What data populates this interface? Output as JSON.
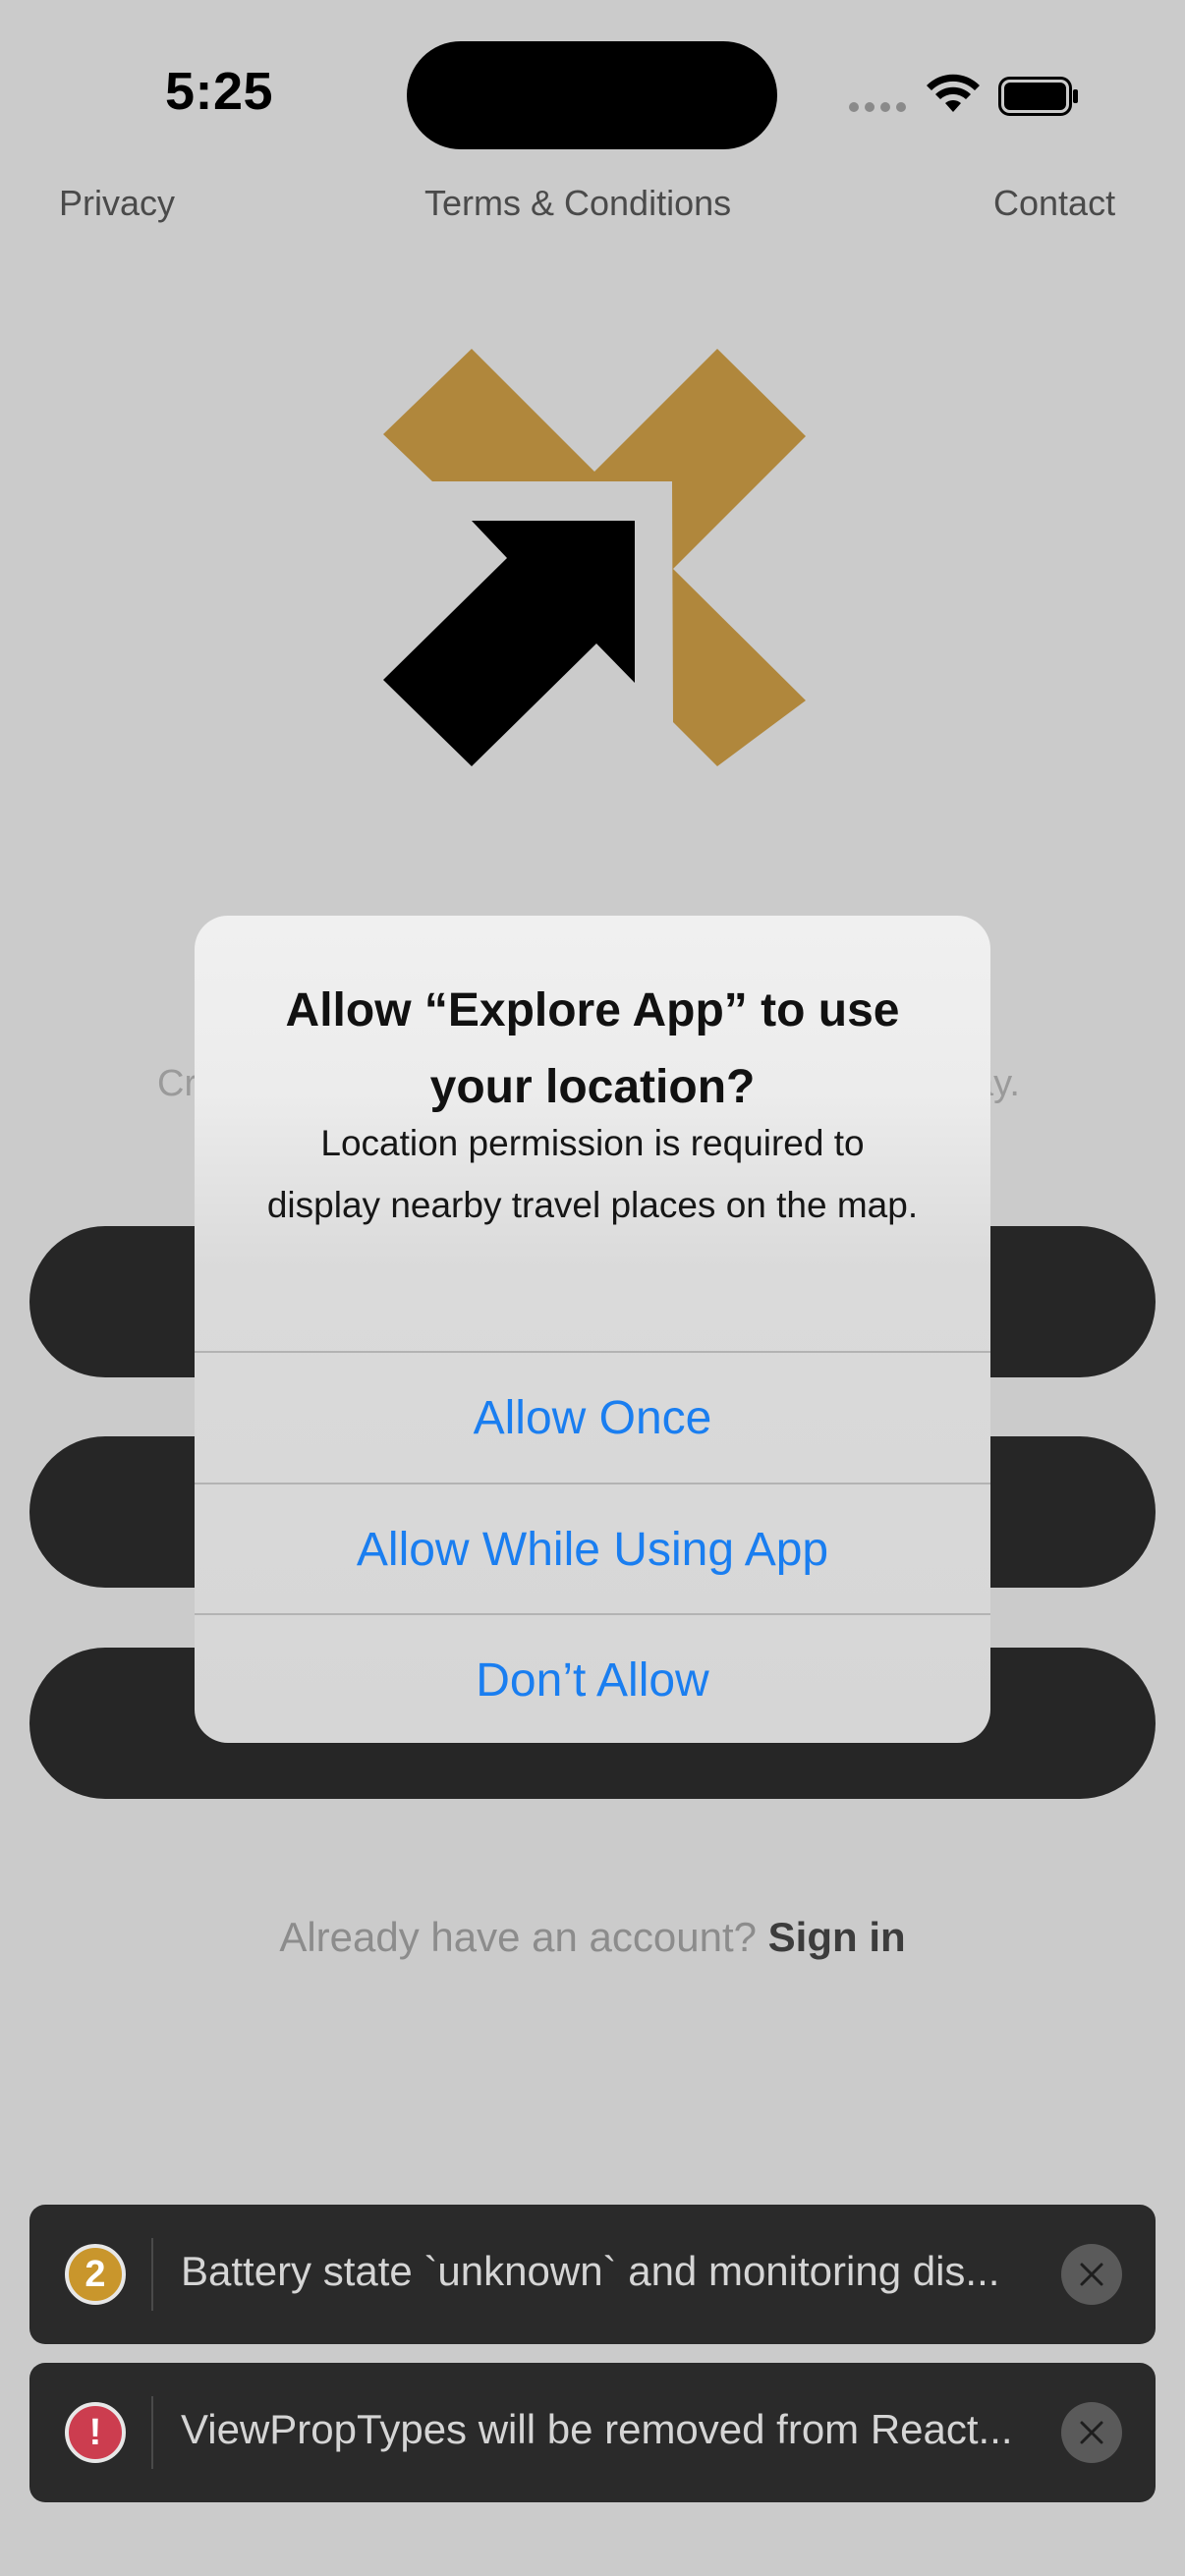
{
  "status_bar": {
    "time": "5:25",
    "icons": [
      "cellular-signal-icon",
      "wifi-icon",
      "battery-icon"
    ]
  },
  "top_links": {
    "privacy": "Privacy",
    "terms": "Terms & Conditions",
    "contact": "Contact"
  },
  "logo": {
    "icon": "app-logo-arrow-icon",
    "colors": {
      "gold": "#b0873c",
      "dark": "#000000"
    }
  },
  "background_tagline": {
    "left_fragment": "Cr",
    "right_fragment": "ay."
  },
  "signin": {
    "prompt": "Already have an account?",
    "link": "Sign in"
  },
  "alert": {
    "title": "Allow “Explore App” to use your location?",
    "message": "Location permission is required to display nearby travel places on the map.",
    "buttons": {
      "allow_once": "Allow Once",
      "allow_while_using": "Allow While Using App",
      "dont_allow": "Don’t Allow"
    },
    "accent_color": "#1a7ef0"
  },
  "log_toasts": [
    {
      "badge": "2",
      "badge_color": "#c9962c",
      "icon": "warning-count-icon",
      "text": "Battery state `unknown` and monitoring dis..."
    },
    {
      "badge": "!",
      "badge_color": "#cc3d4f",
      "icon": "error-icon",
      "text": "ViewPropTypes will be removed from React..."
    }
  ]
}
